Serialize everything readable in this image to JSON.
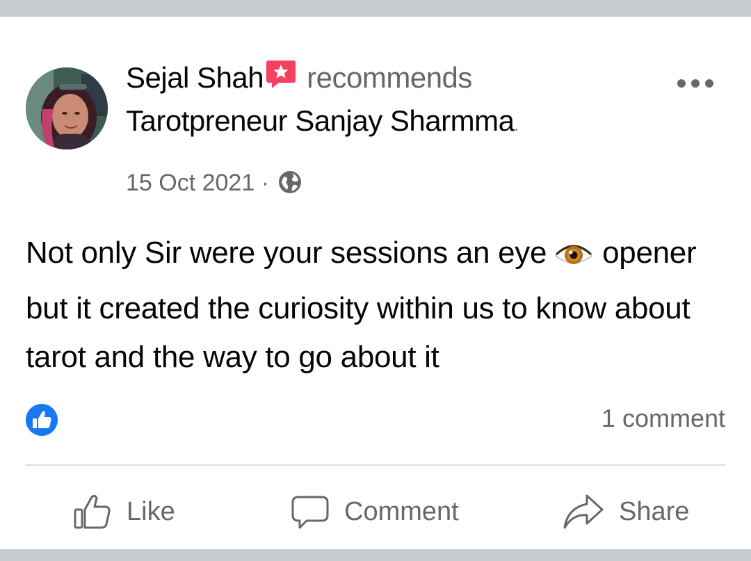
{
  "post": {
    "author": "Sejal Shah",
    "action": "recommends",
    "page_name": "Tarotpreneur Sanjay Sharmma",
    "page_suffix": ".",
    "date": "15 Oct 2021",
    "separator": "·",
    "audience_icon": "globe-icon",
    "text_part1": "Not only Sir were your sessions an eye",
    "text_part2": "opener but it created the curiosity within us to know about tarot and the way to go about it",
    "eye_emoji": "eye-emoji"
  },
  "reactions": {
    "icon": "like-reaction-icon",
    "comment_count": "1 comment"
  },
  "actions": {
    "like_label": "Like",
    "comment_label": "Comment",
    "share_label": "Share"
  },
  "colors": {
    "text_primary": "#050505",
    "text_secondary": "#65676b",
    "brand_blue": "#1877f2",
    "badge_pink": "#f3425f",
    "divider": "#dadde1",
    "page_background": "#c9ccd1"
  }
}
